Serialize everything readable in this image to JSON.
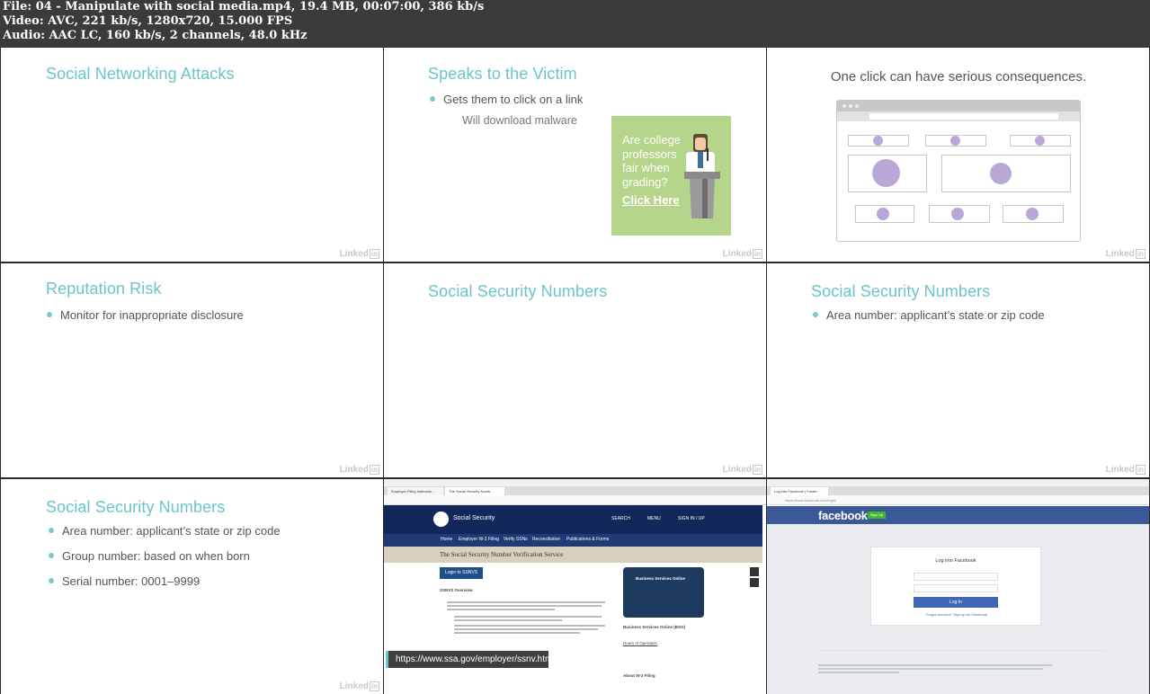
{
  "file_info": {
    "line1": "File: 04 - Manipulate with social media.mp4, 19.4 MB, 00:07:00, 386 kb/s",
    "line2": "Video: AVC, 221 kb/s, 1280x720, 15.000 FPS",
    "line3": "Audio: AAC LC, 160 kb/s, 2 channels, 48.0 kHz"
  },
  "watermark": "Linked",
  "watermark_in": "in",
  "slides": {
    "s1": {
      "title": "Social Networking Attacks"
    },
    "s2": {
      "title": "Speaks to the Victim",
      "bullet1": "Gets them to click on a link",
      "sub1": "Will download malware",
      "ad_text": "Are college professors fair when grading?",
      "ad_link": "Click Here"
    },
    "s3": {
      "title": "One click can have serious consequences."
    },
    "s4": {
      "title": "Reputation Risk",
      "bullet1": "Monitor for inappropriate disclosure"
    },
    "s5": {
      "title": "Social Security Numbers"
    },
    "s6": {
      "title": "Social Security Numbers",
      "bullet1": "Area number: applicant’s state or zip code"
    },
    "s7": {
      "title": "Social Security Numbers",
      "bullet1": "Area number: applicant’s state or zip code",
      "bullet2": "Group number: based on when born",
      "bullet3": "Serial number: 0001–9999"
    },
    "s8": {
      "tab1": "Employer Filing Instructio...",
      "tab2": "The Social Security Numb...",
      "brand": "Social Security",
      "search": "SEARCH",
      "menu": "MENU",
      "signin": "SIGN IN / UP",
      "nav": [
        "Home",
        "Employer W-2 Filing",
        "Verify SSNs",
        "Reconciliation",
        "Publications & Forms"
      ],
      "banner": "The Social Security Number Verification Service",
      "login_button": "Login to SSNVS",
      "overview_heading": "SSNVS Overview",
      "bso_title": "Business Services Online",
      "bso_heading": "Business Services Online (BSO)",
      "hours_label": "Hours of Operation",
      "about_heading": "About W-2 Filing",
      "url_tooltip": "https://www.ssa.gov/employer/ssnv.htm"
    },
    "s9": {
      "tab1": "Log into Facebook | Faceb...",
      "url": "https://www.facebook.com/login/",
      "logo": "facebook",
      "signup": "Sign Up",
      "login_title": "Log into Facebook",
      "login_button": "Log In",
      "forgot": "Forgot account?",
      "signup_link": "Sign up for Facebook"
    }
  },
  "colors": {
    "accent": "#6bc4c9",
    "ssa_navy": "#12285a",
    "facebook_blue": "#3b5998",
    "ad_green": "#b5d68a"
  }
}
